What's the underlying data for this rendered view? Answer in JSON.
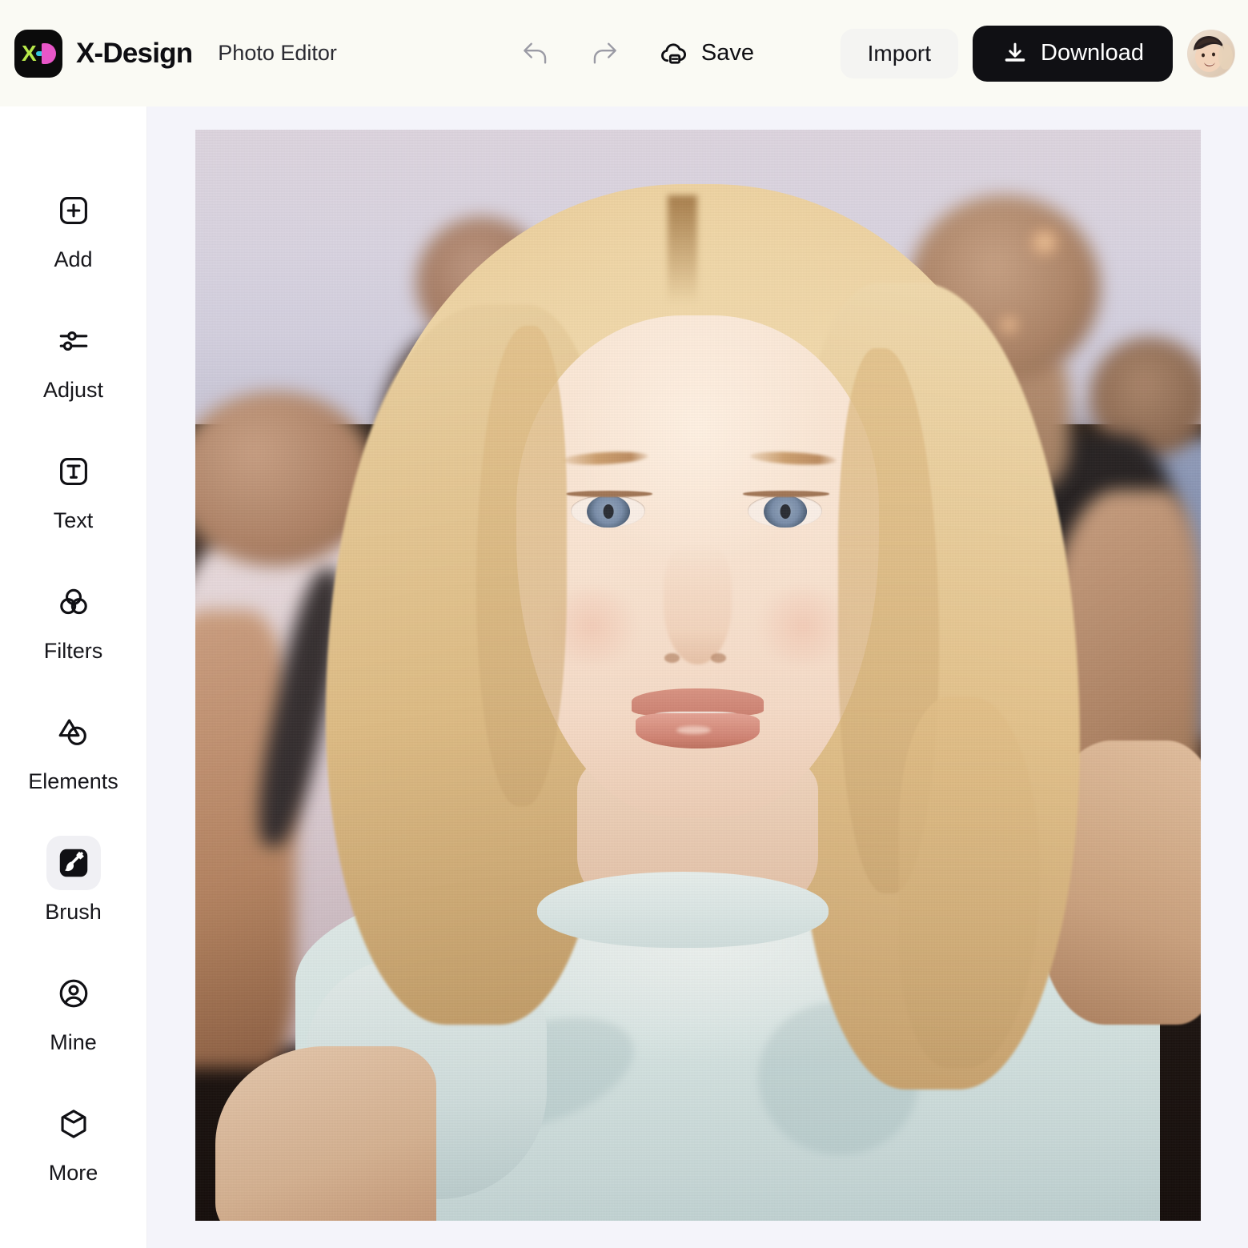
{
  "header": {
    "brand_name": "X-Design",
    "page_subtitle": "Photo Editor",
    "undo_label": "Undo",
    "redo_label": "Redo",
    "save_label": "Save",
    "import_label": "Import",
    "download_label": "Download",
    "avatar_label": "User account",
    "logo_letters": {
      "x": "X",
      "d": "D"
    },
    "colors": {
      "header_bg": "#FAFAF4",
      "logo_bg": "#0B0B0B",
      "logo_green": "#B7E84A",
      "logo_cyan": "#35C7E0",
      "logo_pink": "#E856C8",
      "download_bg": "#101014",
      "import_bg": "#F4F4F2"
    }
  },
  "sidebar": {
    "items": [
      {
        "id": "add",
        "label": "Add",
        "icon": "plus-square-icon",
        "active": false
      },
      {
        "id": "adjust",
        "label": "Adjust",
        "icon": "sliders-icon",
        "active": false
      },
      {
        "id": "text",
        "label": "Text",
        "icon": "text-square-icon",
        "active": false
      },
      {
        "id": "filters",
        "label": "Filters",
        "icon": "filters-circles-icon",
        "active": false
      },
      {
        "id": "elements",
        "label": "Elements",
        "icon": "shapes-icon",
        "active": false
      },
      {
        "id": "brush",
        "label": "Brush",
        "icon": "brush-icon",
        "active": true
      },
      {
        "id": "mine",
        "label": "Mine",
        "icon": "user-circle-icon",
        "active": false
      },
      {
        "id": "more",
        "label": "More",
        "icon": "cube-icon",
        "active": false
      }
    ],
    "colors": {
      "bg": "#FFFFFF",
      "active_bg": "#F0F0F4",
      "label": "#16161B"
    }
  },
  "canvas": {
    "bg": "#F4F4FA",
    "photo_alt": "Portrait of a blonde woman in a pale mint t-shirt at an outdoor evening gathering, with blurred people in the background"
  }
}
